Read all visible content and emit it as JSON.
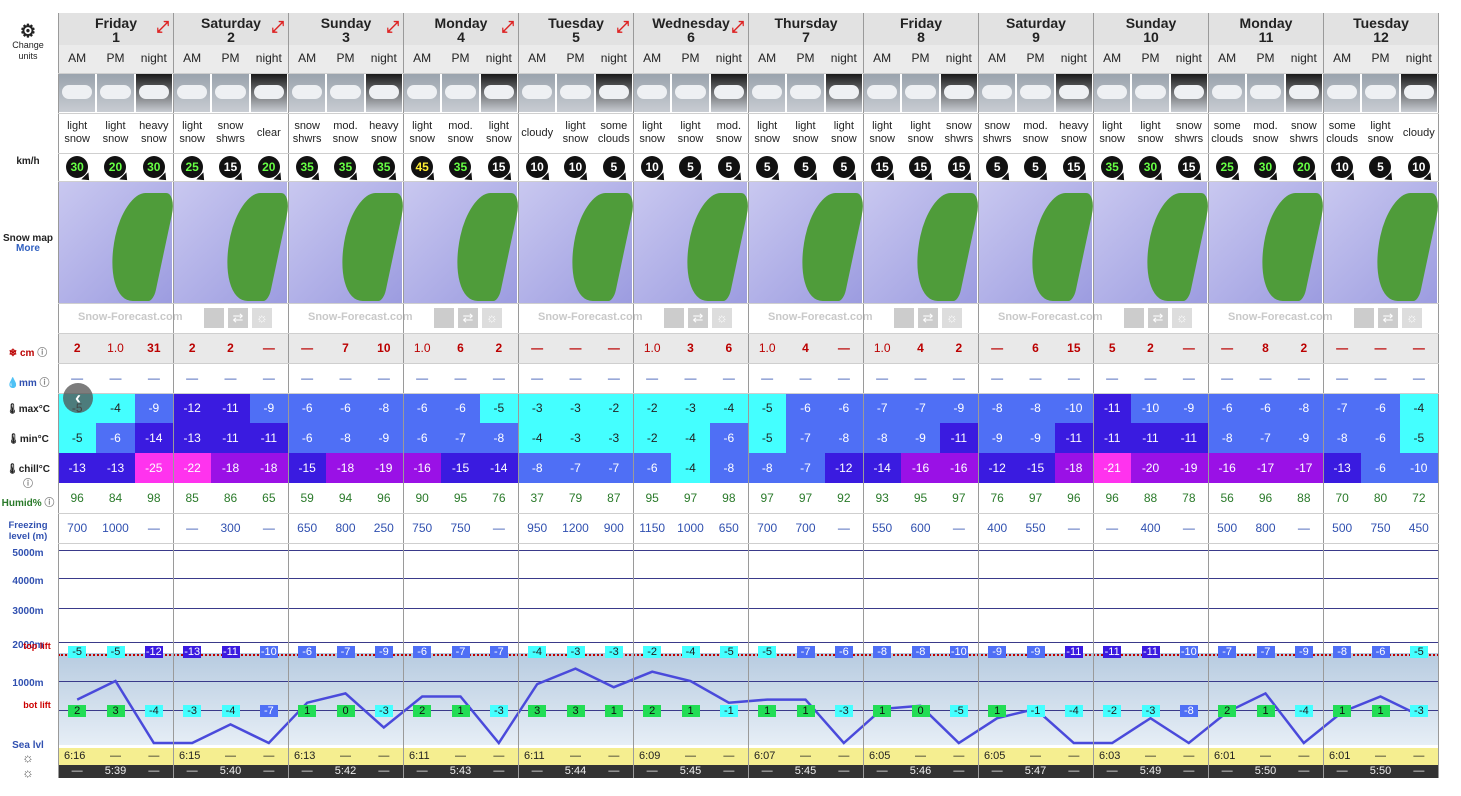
{
  "units_button": {
    "label": "Change units"
  },
  "row_labels": {
    "wind": "km/h",
    "snow_map": "Snow map",
    "more": "More",
    "snow": "cm",
    "rain": "mm",
    "max": "max°C",
    "min": "min°C",
    "chill": "chill°C",
    "humid": "Humid%",
    "freezing": "Freezing level (m)",
    "alt_5000": "5000m",
    "alt_4000": "4000m",
    "alt_3000": "3000m",
    "alt_2000": "2000m",
    "alt_1000": "1000m",
    "top_lift": "top lift",
    "bot_lift": "bot lift",
    "sea_level": "Sea lvl"
  },
  "brand": "Snow-Forecast.com",
  "periods": [
    "AM",
    "PM",
    "night"
  ],
  "days": [
    {
      "name": "Friday",
      "date": "1"
    },
    {
      "name": "Saturday",
      "date": "2"
    },
    {
      "name": "Sunday",
      "date": "3"
    },
    {
      "name": "Monday",
      "date": "4"
    },
    {
      "name": "Tuesday",
      "date": "5"
    },
    {
      "name": "Wednesday",
      "date": "6"
    },
    {
      "name": "Thursday",
      "date": "7"
    },
    {
      "name": "Friday",
      "date": "8"
    },
    {
      "name": "Saturday",
      "date": "9"
    },
    {
      "name": "Sunday",
      "date": "10"
    },
    {
      "name": "Monday",
      "date": "11"
    },
    {
      "name": "Tuesday",
      "date": "12"
    }
  ],
  "weather": [
    "light snow",
    "light snow",
    "heavy snow",
    "light snow",
    "snow shwrs",
    "clear",
    "snow shwrs",
    "mod. snow",
    "heavy snow",
    "light snow",
    "mod. snow",
    "light snow",
    "cloudy",
    "light snow",
    "some clouds",
    "light snow",
    "light snow",
    "mod. snow",
    "light snow",
    "light snow",
    "light snow",
    "light snow",
    "light snow",
    "snow shwrs",
    "snow shwrs",
    "mod. snow",
    "heavy snow",
    "light snow",
    "light snow",
    "snow shwrs",
    "some clouds",
    "mod. snow",
    "snow shwrs",
    "some clouds",
    "light snow",
    "cloudy"
  ],
  "wind": [
    "30",
    "20",
    "30",
    "25",
    "15",
    "20",
    "35",
    "35",
    "35",
    "45",
    "35",
    "15",
    "10",
    "10",
    "5",
    "10",
    "5",
    "5",
    "5",
    "5",
    "5",
    "15",
    "15",
    "15",
    "5",
    "5",
    "15",
    "35",
    "30",
    "15",
    "25",
    "30",
    "20",
    "10",
    "5",
    "10"
  ],
  "snow_cm": [
    "2",
    "1.0",
    "31",
    "2",
    "2",
    "—",
    "—",
    "7",
    "10",
    "1.0",
    "6",
    "2",
    "—",
    "—",
    "—",
    "1.0",
    "3",
    "6",
    "1.0",
    "4",
    "—",
    "1.0",
    "4",
    "2",
    "—",
    "6",
    "15",
    "5",
    "2",
    "—",
    "—",
    "8",
    "2",
    "—",
    "—",
    "—"
  ],
  "rain_mm": [
    "—",
    "—",
    "—",
    "—",
    "—",
    "—",
    "—",
    "—",
    "—",
    "—",
    "—",
    "—",
    "—",
    "—",
    "—",
    "—",
    "—",
    "—",
    "—",
    "—",
    "—",
    "—",
    "—",
    "—",
    "—",
    "—",
    "—",
    "—",
    "—",
    "—",
    "—",
    "—",
    "—",
    "—",
    "—",
    "—"
  ],
  "max_c": [
    "-5",
    "-4",
    "-9",
    "-12",
    "-11",
    "-9",
    "-6",
    "-6",
    "-8",
    "-6",
    "-6",
    "-5",
    "-3",
    "-3",
    "-2",
    "-2",
    "-3",
    "-4",
    "-5",
    "-6",
    "-6",
    "-7",
    "-7",
    "-9",
    "-8",
    "-8",
    "-10",
    "-11",
    "-10",
    "-9",
    "-6",
    "-6",
    "-8",
    "-7",
    "-6",
    "-4"
  ],
  "min_c": [
    "-5",
    "-6",
    "-14",
    "-13",
    "-11",
    "-11",
    "-6",
    "-8",
    "-9",
    "-6",
    "-7",
    "-8",
    "-4",
    "-3",
    "-3",
    "-2",
    "-4",
    "-6",
    "-5",
    "-7",
    "-8",
    "-8",
    "-9",
    "-11",
    "-9",
    "-9",
    "-11",
    "-11",
    "-11",
    "-11",
    "-8",
    "-7",
    "-9",
    "-8",
    "-6",
    "-5"
  ],
  "chill_c": [
    "-13",
    "-13",
    "-25",
    "-22",
    "-18",
    "-18",
    "-15",
    "-18",
    "-19",
    "-16",
    "-15",
    "-14",
    "-8",
    "-7",
    "-7",
    "-6",
    "-4",
    "-8",
    "-8",
    "-7",
    "-12",
    "-14",
    "-16",
    "-16",
    "-12",
    "-15",
    "-18",
    "-21",
    "-20",
    "-19",
    "-16",
    "-17",
    "-17",
    "-13",
    "-6",
    "-10"
  ],
  "humid": [
    "96",
    "84",
    "98",
    "85",
    "86",
    "65",
    "59",
    "94",
    "96",
    "90",
    "95",
    "76",
    "37",
    "79",
    "87",
    "95",
    "97",
    "98",
    "97",
    "97",
    "92",
    "93",
    "95",
    "97",
    "76",
    "97",
    "96",
    "96",
    "88",
    "78",
    "56",
    "96",
    "88",
    "70",
    "80",
    "72"
  ],
  "freezing": [
    "700",
    "1000",
    "—",
    "—",
    "300",
    "—",
    "650",
    "800",
    "250",
    "750",
    "750",
    "—",
    "950",
    "1200",
    "900",
    "1150",
    "1000",
    "650",
    "700",
    "700",
    "—",
    "550",
    "600",
    "—",
    "400",
    "550",
    "—",
    "—",
    "400",
    "—",
    "500",
    "800",
    "—",
    "500",
    "750",
    "450"
  ],
  "top_lift": [
    "-5",
    "-5",
    "-12",
    "-13",
    "-11",
    "-10",
    "-6",
    "-7",
    "-9",
    "-6",
    "-7",
    "-7",
    "-4",
    "-3",
    "-3",
    "-2",
    "-4",
    "-5",
    "-5",
    "-7",
    "-6",
    "-8",
    "-8",
    "-10",
    "-9",
    "-9",
    "-11",
    "-11",
    "-11",
    "-10",
    "-7",
    "-7",
    "-9",
    "-8",
    "-6",
    "-5"
  ],
  "bot_lift": [
    "2",
    "3",
    "-4",
    "-3",
    "-4",
    "-7",
    "1",
    "0",
    "-3",
    "2",
    "1",
    "-3",
    "3",
    "3",
    "1",
    "2",
    "1",
    "-1",
    "1",
    "1",
    "-3",
    "1",
    "0",
    "-5",
    "1",
    "-1",
    "-4",
    "-2",
    "-3",
    "-8",
    "2",
    "1",
    "-4",
    "1",
    "1",
    "-3"
  ],
  "sunrise": [
    "6:16",
    "—",
    "—",
    "6:15",
    "—",
    "—",
    "6:13",
    "—",
    "—",
    "6:11",
    "—",
    "—",
    "6:11",
    "—",
    "—",
    "6:09",
    "—",
    "—",
    "6:07",
    "—",
    "—",
    "6:05",
    "—",
    "—",
    "6:05",
    "—",
    "—",
    "6:03",
    "—",
    "—",
    "6:01",
    "—",
    "—",
    "6:01",
    "—",
    "—"
  ],
  "sunset": [
    "—",
    "5:39",
    "—",
    "—",
    "5:40",
    "—",
    "—",
    "5:42",
    "—",
    "—",
    "5:43",
    "—",
    "—",
    "5:44",
    "—",
    "—",
    "5:45",
    "—",
    "—",
    "5:45",
    "—",
    "—",
    "5:46",
    "—",
    "—",
    "5:47",
    "—",
    "—",
    "5:49",
    "—",
    "—",
    "5:50",
    "—",
    "—",
    "5:50",
    "—"
  ],
  "colors": {
    "freezing_line": "#4a4adb",
    "top_lift_line": "#c00000",
    "sunrise_bg": "#f5ee90",
    "sunset_bg": "#333333"
  }
}
